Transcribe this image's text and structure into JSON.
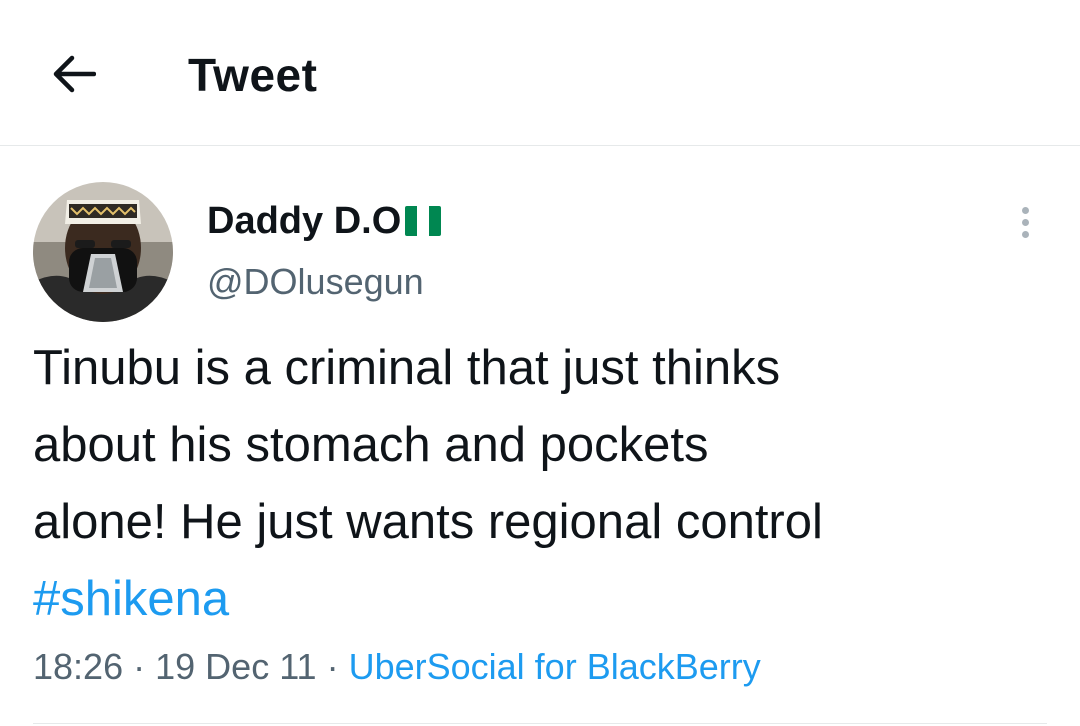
{
  "header": {
    "title": "Tweet",
    "back_icon": "arrow-left-icon"
  },
  "tweet": {
    "author": {
      "display_name": "Daddy D.O",
      "flag_colors": [
        "#008751",
        "#ffffff",
        "#008751"
      ],
      "handle": "@DOlusegun"
    },
    "text_lines": [
      "Tinubu is a criminal that just thinks",
      "about his stomach and pockets",
      "alone! He just wants regional control"
    ],
    "hashtag": "#shikena",
    "time": "18:26",
    "separator": "·",
    "date": "19 Dec 11",
    "source": "UberSocial for BlackBerry",
    "more_icon": "more-vertical-icon"
  },
  "colors": {
    "link": "#1d9bf0",
    "secondary_text": "#536471",
    "primary_text": "#0f1419",
    "divider": "#e6e9ea"
  }
}
